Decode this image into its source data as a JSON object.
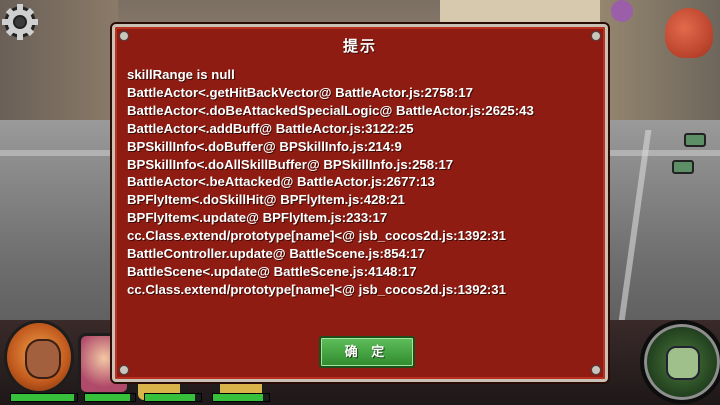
{
  "dialog": {
    "title": "提示",
    "lines": [
      "skillRange is null",
      "BattleActor<.getHitBackVector@ BattleActor.js:2758:17",
      "BattleActor<.doBeAttackedSpecialLogic@ BattleActor.js:2625:43",
      "BattleActor<.addBuff@ BattleActor.js:3122:25",
      "BPSkillInfo<.doBuffer@ BPSkillInfo.js:214:9",
      "BPSkillInfo<.doAllSkillBuffer@ BPSkillInfo.js:258:17",
      "BattleActor<.beAttacked@ BattleActor.js:2677:13",
      "BPFlyItem<.doSkillHit@ BPFlyItem.js:428:21",
      "BPFlyItem<.update@ BPFlyItem.js:233:17",
      "cc.Class.extend/prototype[name]<@ jsb_cocos2d.js:1392:31",
      "BattleController.update@ BattleScene.js:854:17",
      "BattleScene<.update@ BattleScene.js:4148:17",
      "cc.Class.extend/prototype[name]<@ jsb_cocos2d.js:1392:31"
    ],
    "confirm_label": "确 定"
  },
  "hud": {
    "health_bars": [
      {
        "name": "hero-1",
        "fill": 0.95
      },
      {
        "name": "hero-2",
        "fill": 0.9
      },
      {
        "name": "hero-3",
        "fill": 0.9
      },
      {
        "name": "hero-4",
        "fill": 0.9
      }
    ]
  },
  "icons": [
    "gear-icon",
    "skill-fist-icon"
  ],
  "colors": {
    "dialog_bg": "#8f1c13",
    "dialog_border": "#c8c1b4",
    "confirm_button": "#3f9e3b",
    "text": "#ffffff",
    "hp_fill": "#37c03c"
  }
}
